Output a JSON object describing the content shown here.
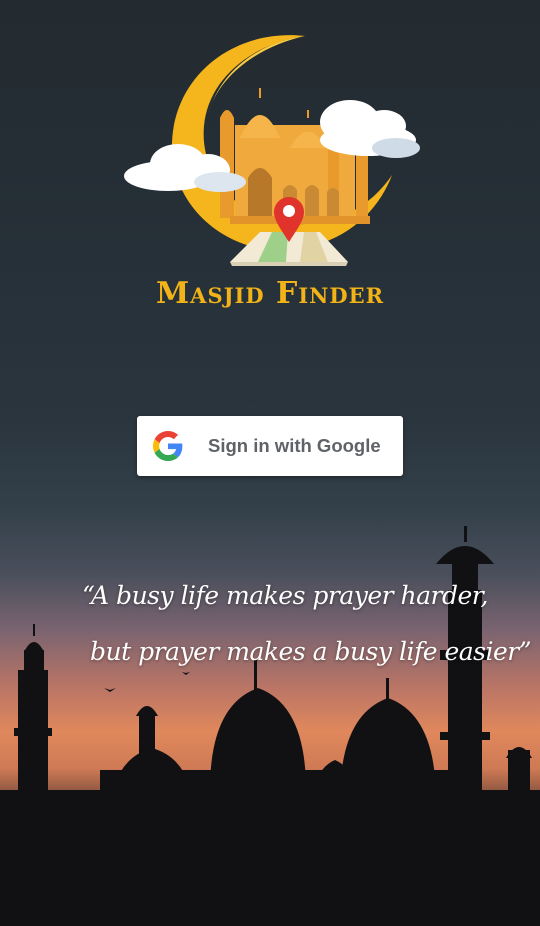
{
  "app": {
    "title": "Masjid Finder"
  },
  "logo": {
    "icon": "masjid-finder-logo",
    "colors": {
      "crescent": "#f5b51c",
      "mosque": "#f0a93c",
      "pin": "#e0332b",
      "cloud": "#ffffff"
    }
  },
  "signin": {
    "label": "Sign in with Google",
    "icon": "google-g-icon"
  },
  "quote": {
    "line1": "“A busy life makes prayer harder,",
    "line2": "but prayer makes a busy life easier”"
  },
  "background": {
    "top_color": "#232b30",
    "sunset_color": "#e0885c",
    "bottom_color": "#111114"
  }
}
